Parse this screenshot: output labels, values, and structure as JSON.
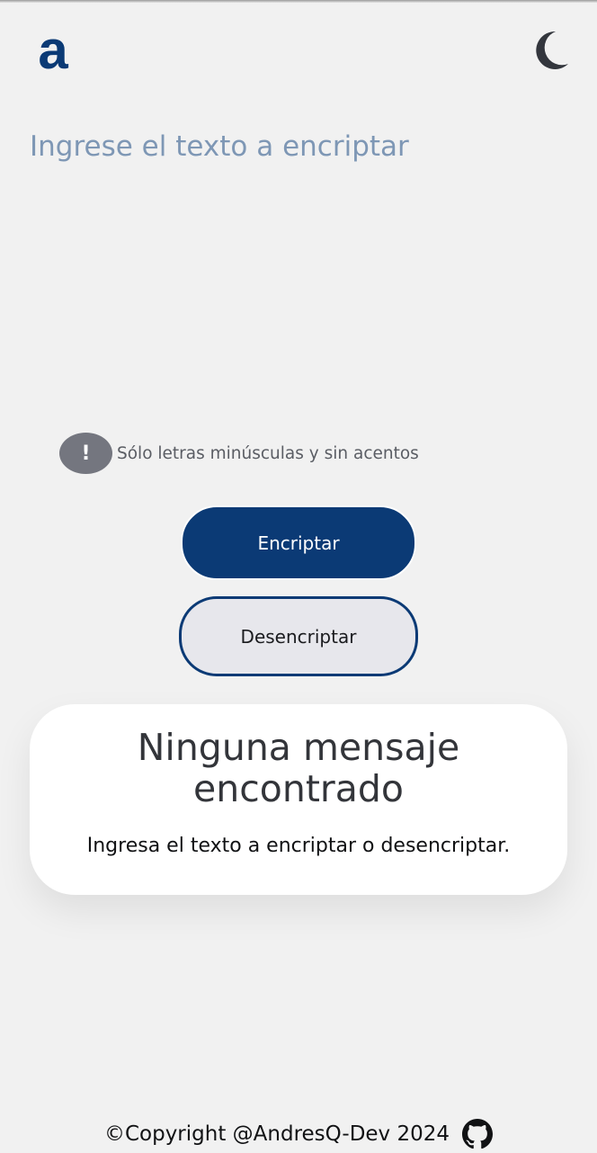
{
  "header": {
    "logo_letter": "a",
    "theme_toggle_icon": "moon-icon"
  },
  "input": {
    "placeholder": "Ingrese el texto a encriptar",
    "value": ""
  },
  "hint": {
    "icon_symbol": "!",
    "text": "Sólo letras minúsculas y sin acentos"
  },
  "buttons": {
    "encrypt_label": "Encriptar",
    "decrypt_label": "Desencriptar"
  },
  "result": {
    "title": "Ninguna mensaje encontrado",
    "subtitle": "Ingresa el texto a encriptar o desencriptar."
  },
  "footer": {
    "copyright": "©Copyright @AndresQ-Dev 2024",
    "github_icon": "github-icon"
  },
  "colors": {
    "background": "#f1f1f1",
    "primary": "#0b3a75",
    "placeholder": "#7e97b5",
    "hint_badge": "#74767f",
    "card": "#ffffff"
  }
}
